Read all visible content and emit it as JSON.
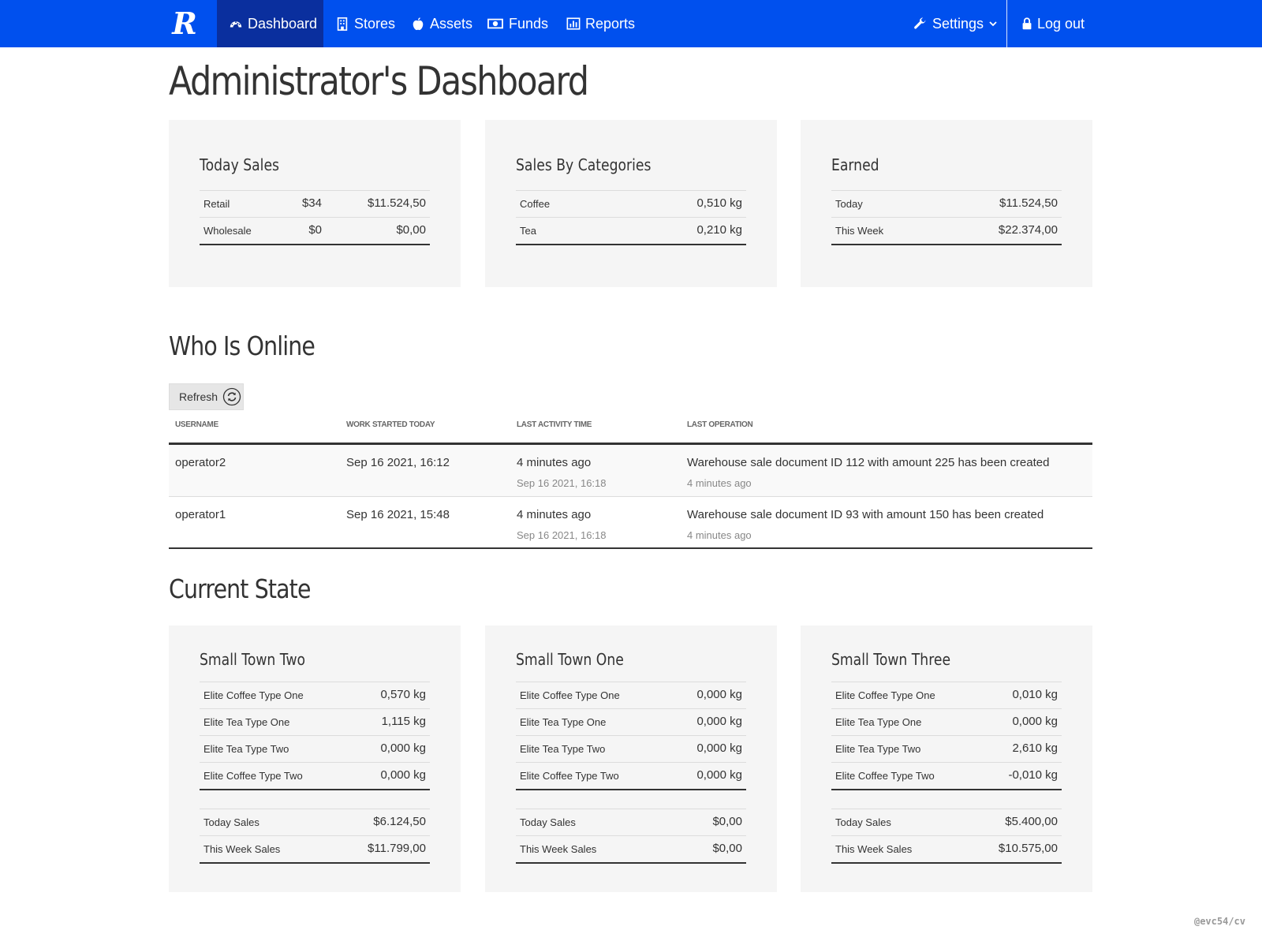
{
  "nav": {
    "brand": "R",
    "items": [
      {
        "label": "Dashboard",
        "icon": "dashboard-gauge-icon"
      },
      {
        "label": "Stores",
        "icon": "building-icon"
      },
      {
        "label": "Assets",
        "icon": "apple-icon"
      },
      {
        "label": "Funds",
        "icon": "money-bill-icon"
      },
      {
        "label": "Reports",
        "icon": "bar-chart-icon"
      }
    ],
    "settings": "Settings",
    "logout": "Log out",
    "accent_color": "#0050ee",
    "active_color": "#0a2f9e"
  },
  "page_title": "Administrator's Dashboard",
  "summary": {
    "today_sales": {
      "title": "Today Sales",
      "rows": [
        {
          "label": "Retail",
          "count": "$34",
          "amount": "$11.524,50"
        },
        {
          "label": "Wholesale",
          "count": "$0",
          "amount": "$0,00"
        }
      ]
    },
    "categories": {
      "title": "Sales By Categories",
      "rows": [
        {
          "label": "Coffee",
          "value": "0,510 kg"
        },
        {
          "label": "Tea",
          "value": "0,210 kg"
        }
      ]
    },
    "earned": {
      "title": "Earned",
      "rows": [
        {
          "label": "Today",
          "value": "$11.524,50"
        },
        {
          "label": "This Week",
          "value": "$22.374,00"
        }
      ]
    }
  },
  "online": {
    "title": "Who Is Online",
    "refresh": "Refresh",
    "columns": [
      "USERNAME",
      "WORK STARTED TODAY",
      "LAST ACTIVITY TIME",
      "LAST OPERATION"
    ],
    "rows": [
      {
        "username": "operator2",
        "started": "Sep 16 2021, 16:12",
        "activity": "4 minutes ago",
        "activity_time": "Sep 16 2021, 16:18",
        "operation": "Warehouse sale document ID 112 with amount 225 has been created",
        "operation_ago": "4 minutes ago"
      },
      {
        "username": "operator1",
        "started": "Sep 16 2021, 15:48",
        "activity": "4 minutes ago",
        "activity_time": "Sep 16 2021, 16:18",
        "operation": "Warehouse sale document ID 93 with amount 150 has been created",
        "operation_ago": "4 minutes ago"
      }
    ]
  },
  "state": {
    "title": "Current State",
    "stores": [
      {
        "name": "Small Town Two",
        "items": [
          {
            "label": "Elite Coffee Type One",
            "value": "0,570 kg"
          },
          {
            "label": "Elite Tea Type One",
            "value": "1,115 kg"
          },
          {
            "label": "Elite Tea Type Two",
            "value": "0,000 kg"
          },
          {
            "label": "Elite Coffee Type Two",
            "value": "0,000 kg"
          }
        ],
        "sales": [
          {
            "label": "Today Sales",
            "value": "$6.124,50"
          },
          {
            "label": "This Week Sales",
            "value": "$11.799,00"
          }
        ]
      },
      {
        "name": "Small Town One",
        "items": [
          {
            "label": "Elite Coffee Type One",
            "value": "0,000 kg"
          },
          {
            "label": "Elite Tea Type One",
            "value": "0,000 kg"
          },
          {
            "label": "Elite Tea Type Two",
            "value": "0,000 kg"
          },
          {
            "label": "Elite Coffee Type Two",
            "value": "0,000 kg"
          }
        ],
        "sales": [
          {
            "label": "Today Sales",
            "value": "$0,00"
          },
          {
            "label": "This Week Sales",
            "value": "$0,00"
          }
        ]
      },
      {
        "name": "Small Town Three",
        "items": [
          {
            "label": "Elite Coffee Type One",
            "value": "0,010 kg"
          },
          {
            "label": "Elite Tea Type One",
            "value": "0,000 kg"
          },
          {
            "label": "Elite Tea Type Two",
            "value": "2,610 kg"
          },
          {
            "label": "Elite Coffee Type Two",
            "value": "-0,010 kg"
          }
        ],
        "sales": [
          {
            "label": "Today Sales",
            "value": "$5.400,00"
          },
          {
            "label": "This Week Sales",
            "value": "$10.575,00"
          }
        ]
      }
    ]
  },
  "watermark": "@evc54/cv"
}
